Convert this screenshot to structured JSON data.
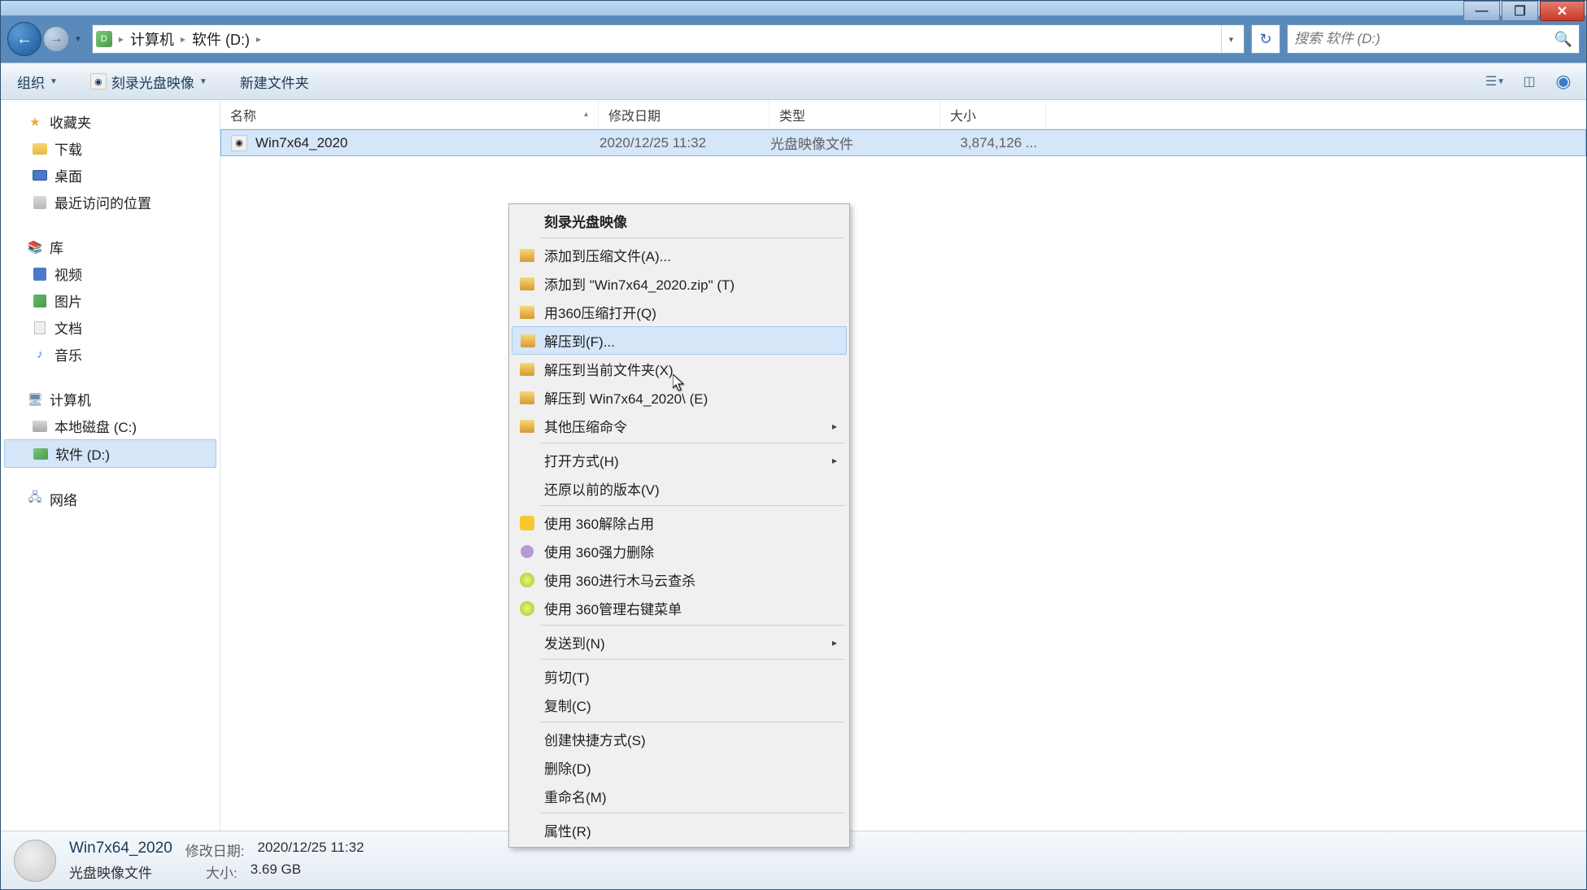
{
  "window": {
    "minimize": "—",
    "maximize": "❐",
    "close": "✕"
  },
  "nav": {
    "back": "←",
    "forward": "→"
  },
  "breadcrumb": {
    "seg1": "计算机",
    "seg2": "软件 (D:)"
  },
  "search": {
    "placeholder": "搜索 软件 (D:)"
  },
  "toolbar": {
    "organize": "组织",
    "burn": "刻录光盘映像",
    "newfolder": "新建文件夹"
  },
  "sidebar": {
    "favorites": {
      "label": "收藏夹",
      "items": [
        {
          "label": "下载",
          "icon": "folder"
        },
        {
          "label": "桌面",
          "icon": "desktop"
        },
        {
          "label": "最近访问的位置",
          "icon": "recent"
        }
      ]
    },
    "libraries": {
      "label": "库",
      "items": [
        {
          "label": "视频",
          "icon": "video"
        },
        {
          "label": "图片",
          "icon": "picture"
        },
        {
          "label": "文档",
          "icon": "doc"
        },
        {
          "label": "音乐",
          "icon": "music"
        }
      ]
    },
    "computer": {
      "label": "计算机",
      "items": [
        {
          "label": "本地磁盘 (C:)",
          "icon": "drive"
        },
        {
          "label": "软件 (D:)",
          "icon": "drive-d",
          "selected": true
        }
      ]
    },
    "network": {
      "label": "网络"
    }
  },
  "columns": {
    "name": "名称",
    "date": "修改日期",
    "type": "类型",
    "size": "大小"
  },
  "files": [
    {
      "name": "Win7x64_2020",
      "date": "2020/12/25 11:32",
      "type": "光盘映像文件",
      "size": "3,874,126 ..."
    }
  ],
  "context": {
    "burn": "刻录光盘映像",
    "addarchive": "添加到压缩文件(A)...",
    "addzip": "添加到 \"Win7x64_2020.zip\" (T)",
    "open360": "用360压缩打开(Q)",
    "extract": "解压到(F)...",
    "extracthere": "解压到当前文件夹(X)",
    "extractto": "解压到 Win7x64_2020\\ (E)",
    "othercomp": "其他压缩命令",
    "openwith": "打开方式(H)",
    "restore": "还原以前的版本(V)",
    "use360unlock": "使用 360解除占用",
    "use360delete": "使用 360强力删除",
    "use360scan": "使用 360进行木马云查杀",
    "use360menu": "使用 360管理右键菜单",
    "sendto": "发送到(N)",
    "cut": "剪切(T)",
    "copy": "复制(C)",
    "shortcut": "创建快捷方式(S)",
    "delete": "删除(D)",
    "rename": "重命名(M)",
    "properties": "属性(R)"
  },
  "status": {
    "filename": "Win7x64_2020",
    "filetype": "光盘映像文件",
    "datelabel": "修改日期:",
    "dateval": "2020/12/25 11:32",
    "sizelabel": "大小:",
    "sizeval": "3.69 GB"
  }
}
